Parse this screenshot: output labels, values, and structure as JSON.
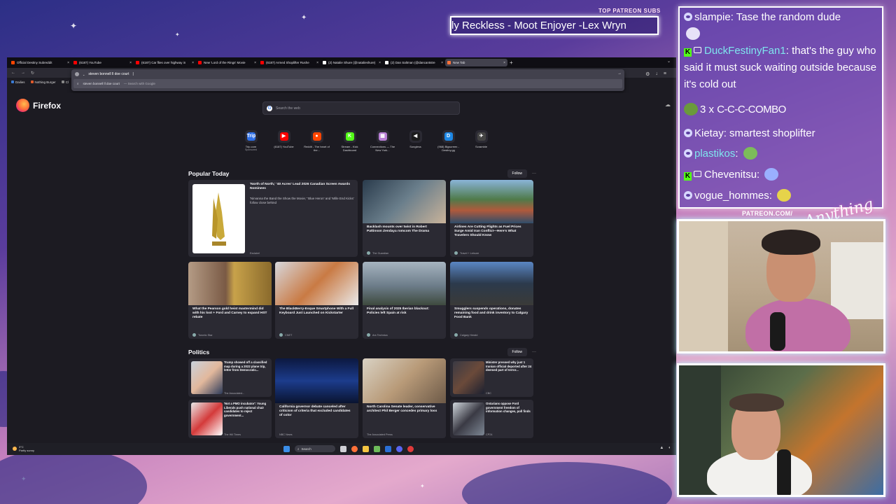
{
  "overlay": {
    "patreon_label": "TOP PATREON SUBS",
    "ticker_text": "estly Reckless - Moot Enjoyer -Lex Wryn",
    "patreon_url": "PATREON.COM/",
    "signature": "Anything"
  },
  "browser": {
    "tabs": [
      {
        "title": "Official Destiny Subreddit",
        "color": "#ff4500"
      },
      {
        "title": "(6187) YouTube",
        "color": "#ff0000"
      },
      {
        "title": "(6187) Car flies over highway in",
        "color": "#ff0000"
      },
      {
        "title": "New 'Lord of the Rings' Movie",
        "color": "#ff0000"
      },
      {
        "title": "(6187) Armed Shoplifter Rushe",
        "color": "#ff0000"
      },
      {
        "title": "(2) Natalie Shure (@natalieshure)",
        "color": "#ffffff"
      },
      {
        "title": "(2) Dan Saltman (@dancantstre",
        "color": "#ffffff"
      },
      {
        "title": "New Tab",
        "color": "#ff7139",
        "active": true
      }
    ],
    "newtab_symbol": "+",
    "urlbar": {
      "value": "steven bonnell ll doe court",
      "suggestion": "steven bonnell ll doe court",
      "suggestion_hint": "— Search with Google"
    },
    "bookmarks": [
      {
        "label": "Dailies",
        "color": "#3a7bd5"
      },
      {
        "label": "Nothing Burger",
        "color": "#e05a2b"
      },
      {
        "label": "Cl",
        "color": "#888"
      }
    ],
    "brand": "Firefox",
    "search_placeholder": "Search the web",
    "shortcuts": [
      {
        "label": "Trip.com",
        "sub": "Sponsored",
        "glyph": "Trip",
        "color": "#2d6fe8"
      },
      {
        "label": "(6187) YouTube",
        "sub": "",
        "glyph": "▶",
        "color": "#ff0000"
      },
      {
        "label": "Reddit - The heart of the...",
        "sub": "",
        "glyph": "●",
        "color": "#ff4500"
      },
      {
        "label": "Stream - Kick Dashboard",
        "sub": "",
        "glyph": "K",
        "color": "#53fc18"
      },
      {
        "label": "Connections — The New York...",
        "sub": "",
        "glyph": "▦",
        "color": "#b980d6"
      },
      {
        "label": "Songless",
        "sub": "",
        "glyph": "◀",
        "color": "#1c1c1c"
      },
      {
        "label": "(968) Bigscreen - Destiny.gg",
        "sub": "",
        "glyph": "D",
        "color": "#1e88e5"
      },
      {
        "label": "Scramble",
        "sub": "",
        "glyph": "✈",
        "color": "#444"
      }
    ],
    "popular": {
      "heading": "Popular Today",
      "follow": "Follow",
      "big_card": {
        "title": "'North of North,' '40 Acres' Lead 2026 Canadian Screen Awards Nominees",
        "desc": "'Nirvanna the Band the Show the Movie,' 'Blue Heron' and 'Mille End Kicks' follow close behind",
        "source": "Exclaim!"
      },
      "cards": [
        {
          "title": "Backlash mounts over twist in Robert Pattinson Zendaya romcom The Drama",
          "source": "The Guardian",
          "img": "linear-gradient(135deg,#2a3b4c,#6b7f8c 50%,#c9b39a)"
        },
        {
          "title": "Airlines Are Cutting Flights as Fuel Prices Surge Amid Iran Conflict—Here's What Travelers Should Know",
          "source": "Travel + Leisure",
          "img": "linear-gradient(180deg,#8ab4d8 0%,#4f7a4a 45%,#b05a3c 70%,#2f4d6a 100%)"
        },
        {
          "title": "What the Pearson gold heist mastermind did with his loot + Ford and Carney to expand HST rebate",
          "source": "Toronto Star",
          "img": "linear-gradient(90deg,#b49b85 0%,#7a5a45 45%,#c8a24a 55%,#8a6a2c 100%)"
        },
        {
          "title": "The BlackBerry-Esque Smartphone With a Full Keyboard Just Launched on Kickstarter",
          "source": "CNET",
          "img": "linear-gradient(135deg,#d7d7dc,#c97a44 50%,#eaeaea)"
        },
        {
          "title": "Final analysis of 2025 Iberian blackout: Policies left Spain at risk",
          "source": "Ars Technica",
          "img": "linear-gradient(180deg,#a6b4c0 0%,#6d7d8a 55%,#3e4a3e 100%)"
        },
        {
          "title": "Smugglers suspends operations, donates remaining food and drink inventory to Calgary Food Bank",
          "source": "Calgary Herald",
          "img": "linear-gradient(180deg,#5a86c4 0%,#2c3a4c 50%,#3a3a38 100%)"
        }
      ]
    },
    "politics": {
      "heading": "Politics",
      "follow": "Follow",
      "small_cards": [
        {
          "title": "Trump showed off a classified map during a 2022 plane trip, letter from Democratic...",
          "source": "The Associated...",
          "img": "linear-gradient(135deg,#c9d2dc,#e2b89c 50%,#2d3b5a)"
        },
        {
          "title": "Minister pressed why just 1 Iranian official deported after 24 deemed part of terror...",
          "source": "CBC",
          "img": "linear-gradient(135deg,#3a3a44,#6b4a3a 50%,#1c2030)"
        },
        {
          "title": "'Not a PMO incubator': Young Liberals push national chair candidates to reject government...",
          "source": "The Hill Times",
          "img": "linear-gradient(135deg,#e8e8e8,#d43a3a 50%,#ffffff)"
        },
        {
          "title": "Ontarians oppose Ford government freedom of information changes, poll finds",
          "source": "CP24",
          "img": "linear-gradient(135deg,#d0d6dc,#3a3a44 50%,#7d8794)"
        }
      ],
      "cards": [
        {
          "title": "California governor debate canceled after criticism of criteria that excluded candidates of color",
          "source": "NBC News",
          "img": "linear-gradient(180deg,#0c1840 0%,#1c3c8c 50%,#0a1430 100%)"
        },
        {
          "title": "North Carolina Senate leader, conservative architect Phil Berger concedes primary loss",
          "source": "The Associated Press",
          "img": "linear-gradient(135deg,#d9d2c4,#b89a78 50%,#6d5a48)"
        }
      ]
    },
    "taskbar": {
      "temp": "3°C",
      "weather": "Partly sunny",
      "search": "Search"
    }
  },
  "chat": {
    "messages": [
      {
        "badge": "dgg",
        "user": "slampie",
        "user_color": "#ffffff",
        "text": "Tase the random dude"
      },
      {
        "badge": "kick",
        "user": "DuckFestinyFan1",
        "user_color": "#7fe6ee",
        "text": "that's the guy who said it must suck waiting outside because it's cold out"
      },
      {
        "badge": "combo",
        "user": "3 x",
        "user_color": "#ffffff",
        "text": "C-C-C-COMBO"
      },
      {
        "badge": "dgg",
        "user": "Kietay",
        "user_color": "#ffffff",
        "text": "smartest shoplifter"
      },
      {
        "badge": "dgg",
        "user": "plastikos",
        "user_color": "#7fe6ee",
        "text": ""
      },
      {
        "badge": "kick",
        "user": "Chevenitsu",
        "user_color": "#ffffff",
        "text": ""
      },
      {
        "badge": "dgg",
        "user": "vogue_hommes",
        "user_color": "#ffffff",
        "text": ""
      }
    ]
  }
}
